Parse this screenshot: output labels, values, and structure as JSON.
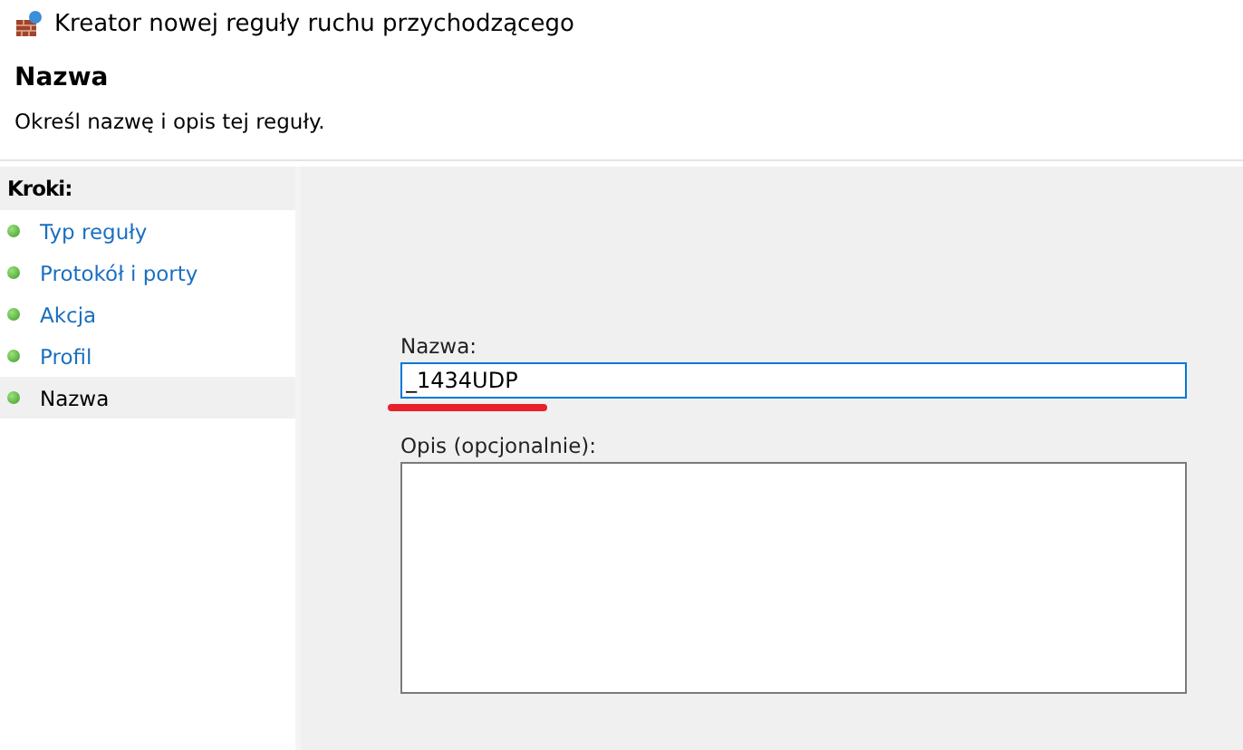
{
  "window": {
    "title": "Kreator nowej reguły ruchu przychodzącego"
  },
  "header": {
    "title": "Nazwa",
    "subtitle": "Określ nazwę i opis tej reguły."
  },
  "sidebar": {
    "heading": "Kroki:",
    "items": [
      {
        "label": "Typ reguły",
        "selected": false
      },
      {
        "label": "Protokół i porty",
        "selected": false
      },
      {
        "label": "Akcja",
        "selected": false
      },
      {
        "label": "Profil",
        "selected": false
      },
      {
        "label": "Nazwa",
        "selected": true
      }
    ]
  },
  "form": {
    "name_label": "Nazwa:",
    "name_value": "_1434UDP",
    "name_focused": true,
    "description_label": "Opis (opcjonalnie):"
  }
}
